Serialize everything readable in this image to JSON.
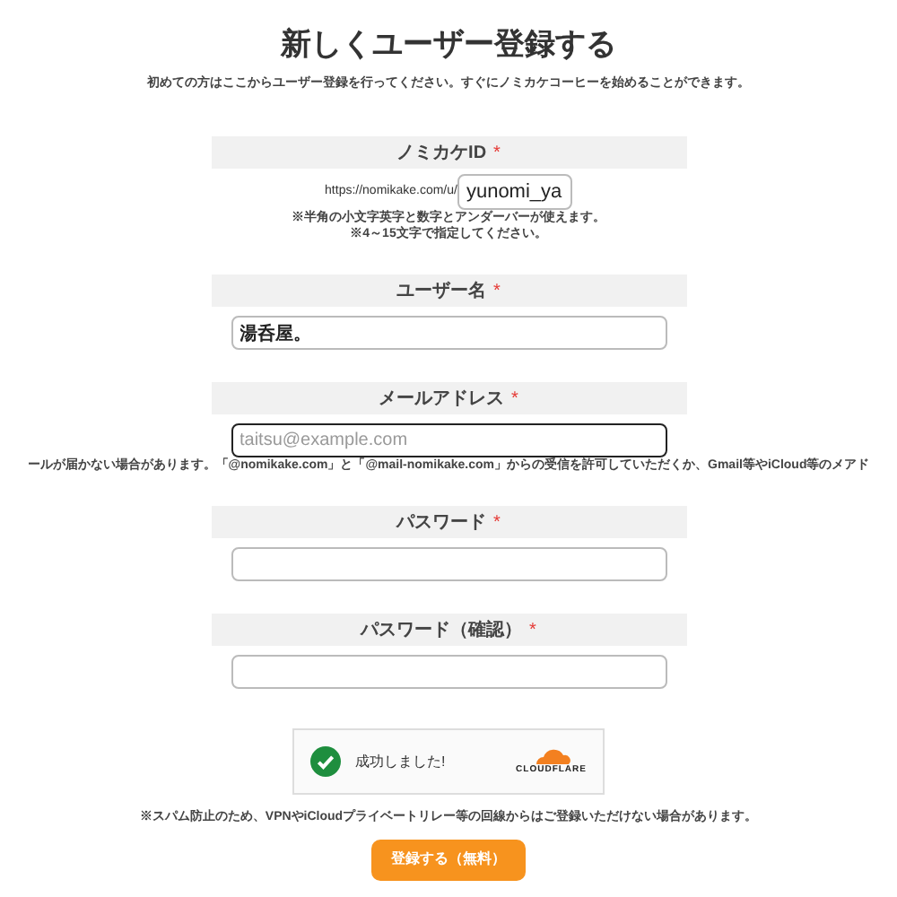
{
  "title": "新しくユーザー登録する",
  "subtitle": "初めての方はここからユーザー登録を行ってください。すぐにノミカケコーヒーを始めることができます。",
  "fields": [
    {
      "kind": "url",
      "label": "ノミカケID",
      "required_mark": "*",
      "prefix": "https://nomikake.com/u/",
      "value": "yunomi_ya",
      "focused": false,
      "notes": [
        "※半角の小文字英字と数字とアンダーバーが使えます。",
        "※4～15文字で指定してください。"
      ]
    },
    {
      "kind": "text",
      "label": "ユーザー名",
      "required_mark": "*",
      "value": "湯呑屋。",
      "focused": false
    },
    {
      "kind": "text",
      "label": "メールアドレス",
      "required_mark": "*",
      "placeholder": "taitsu@example.com",
      "focused": true,
      "notes": [
        "ールが届かない場合があります。「@nomikake.com」と「@mail-nomikake.com」からの受信を許可していただくか、Gmail等やiCloud等のメアド"
      ]
    },
    {
      "kind": "password",
      "label": "パスワード",
      "required_mark": "*",
      "focused": false
    },
    {
      "kind": "password",
      "label": "パスワード（確認）",
      "required_mark": "*",
      "focused": false
    }
  ],
  "captcha": {
    "status": "成功しました!",
    "brand": "CLOUDFLARE"
  },
  "notice": "※スパム防止のため、VPNやiCloudプライベートリレー等の回線からはご登録いただけない場合があります。",
  "submit": "登録する（無料）"
}
